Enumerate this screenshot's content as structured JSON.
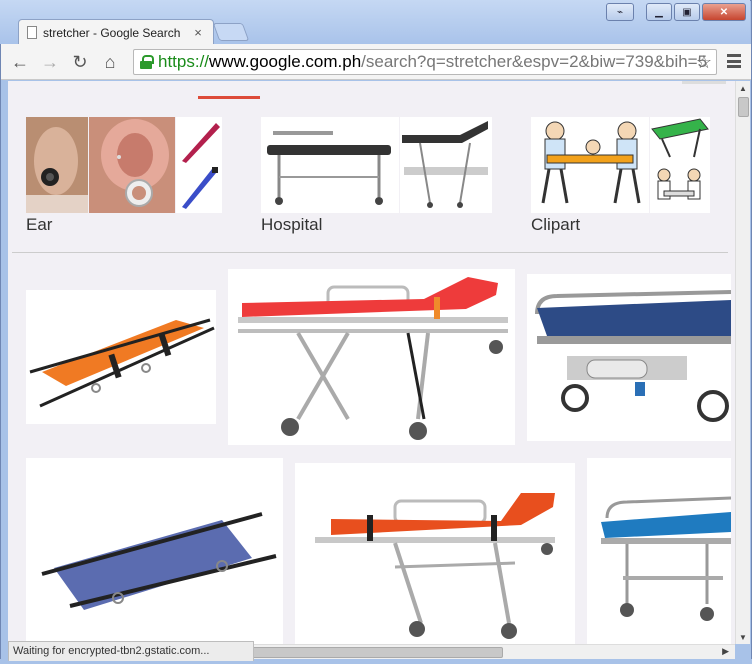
{
  "window": {
    "tab_title": "stretcher - Google Search",
    "tab_close": "×",
    "controls": {
      "extension": "⌁",
      "minimize": "▁",
      "maximize": "▣",
      "close": "✕"
    }
  },
  "toolbar": {
    "back": "←",
    "forward": "→",
    "reload": "↻",
    "home": "⌂",
    "url_scheme": "https://",
    "url_host": "www.google.com.ph",
    "url_path": "/search?q=stretcher&espv=2&biw=739&bih=5",
    "star": "☆"
  },
  "related_searches": [
    {
      "label": "Ear"
    },
    {
      "label": "Hospital"
    },
    {
      "label": "Clipart"
    }
  ],
  "status_text": "Waiting for encrypted-tbn2.gstatic.com...",
  "colors": {
    "accent_red": "#dd4b39",
    "orange": "#f07a23",
    "red_mattress": "#ee3b3b",
    "navy": "#2d4b86",
    "blue": "#1f7bc0",
    "periwinkle": "#5b6cb0"
  }
}
